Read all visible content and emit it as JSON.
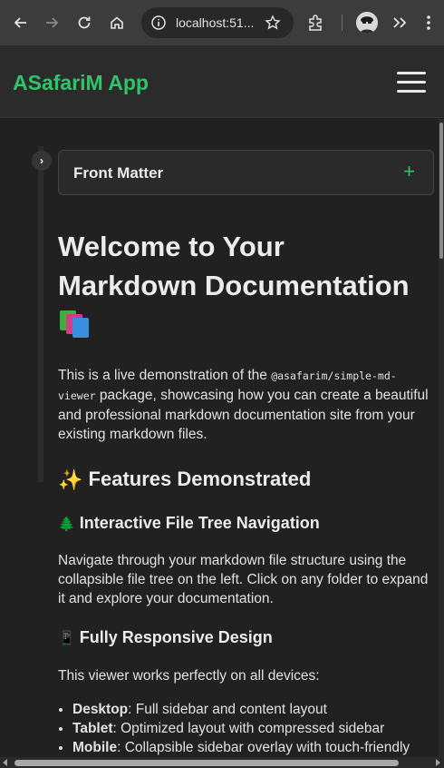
{
  "browser": {
    "url": "localhost:51...",
    "icons": [
      "back-icon",
      "forward-icon",
      "reload-icon",
      "home-icon",
      "site-info-icon",
      "bookmark-star-icon",
      "extensions-icon",
      "profile-avatar",
      "more-tools-icon",
      "menu-kebab-icon"
    ]
  },
  "app": {
    "brand": "ASafariM App",
    "accent": "#2fc46a"
  },
  "front_matter": {
    "toggle": "›",
    "label": "Front Matter",
    "expand": "+"
  },
  "doc": {
    "title": "Welcome to Your Markdown Documentation",
    "intro_before": "This is a live demonstration of the ",
    "intro_code": "@asafarim/simple-md-viewer",
    "intro_after": " package, showcasing how you can create a beautiful and professional markdown documentation site from your existing markdown files.",
    "features_emoji": "✨",
    "features_heading": "Features Demonstrated",
    "tree_emoji": "🌲",
    "tree_heading": "Interactive File Tree Navigation",
    "tree_text": "Navigate through your markdown file structure using the collapsible file tree on the left. Click on any folder to expand it and explore your documentation.",
    "responsive_emoji": "📱",
    "responsive_heading": "Fully Responsive Design",
    "responsive_text": "This viewer works perfectly on all devices:",
    "devices": [
      {
        "label": "Desktop",
        "text": ": Full sidebar and content layout"
      },
      {
        "label": "Tablet",
        "text": ": Optimized layout with compressed sidebar"
      },
      {
        "label": "Mobile",
        "text": ": Collapsible sidebar overlay with touch-friendly navigation"
      }
    ]
  }
}
